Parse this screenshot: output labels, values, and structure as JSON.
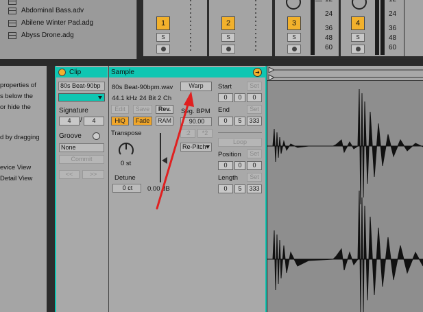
{
  "browser": {
    "items": [
      {
        "label": "Abdominal Bass.adv"
      },
      {
        "label": "Abilene Winter Pad.adg"
      },
      {
        "label": "Abyss Drone.adg"
      }
    ]
  },
  "mixer": {
    "tracks": [
      {
        "number": "1",
        "solo": "S"
      },
      {
        "number": "2",
        "solo": "S"
      },
      {
        "number": "3",
        "solo": "S"
      },
      {
        "number": "4",
        "solo": "S"
      }
    ],
    "db_scale": [
      "12",
      "24",
      "36",
      "48",
      "60"
    ],
    "db_scale_alt": [
      "24",
      "36",
      "48",
      "60"
    ],
    "db_scale_right": [
      "12",
      "24",
      "36",
      "48",
      "60"
    ]
  },
  "info_panel": {
    "lines": [
      "properties of",
      "s below the",
      "or hide the",
      "",
      "d by dragging",
      "",
      "evice View",
      "Detail View"
    ]
  },
  "clip": {
    "header": "Clip",
    "name": "80s Beat-90bp",
    "signature_label": "Signature",
    "sig_num": "4",
    "sig_sep": "/",
    "sig_den": "4",
    "groove_label": "Groove",
    "groove_value": "None",
    "commit": "Commit",
    "nav_left": "<<",
    "nav_right": ">>"
  },
  "sample": {
    "header": "Sample",
    "filename": "80s Beat-90bpm.wav",
    "format": "44.1 kHz 24 Bit 2 Ch",
    "edit": "Edit",
    "save": "Save",
    "rev": "Rev.",
    "hiq": "HiQ",
    "fade": "Fade",
    "ram": "RAM",
    "transpose_label": "Transpose",
    "transpose_value": "0 st",
    "detune_label": "Detune",
    "detune_value": "0 ct",
    "gain_value": "0.00 dB",
    "warp": "Warp",
    "seg_bpm_label": "Seg. BPM",
    "seg_bpm_value": "90.00",
    "half": ":2",
    "double": "*2",
    "warp_mode": "Re-Pitch",
    "start_label": "Start",
    "start_values": [
      "0",
      "0",
      "0"
    ],
    "end_label": "End",
    "end_values": [
      "0",
      "5",
      "333"
    ],
    "loop": "Loop",
    "position_label": "Position",
    "position_values": [
      "0",
      "0",
      "0"
    ],
    "length_label": "Length",
    "length_values": [
      "0",
      "5",
      "333"
    ],
    "set": "Set"
  },
  "colors": {
    "accent_teal": "#0fc6b2",
    "track_orange": "#f2b12c",
    "annotation_red": "#e02020"
  }
}
